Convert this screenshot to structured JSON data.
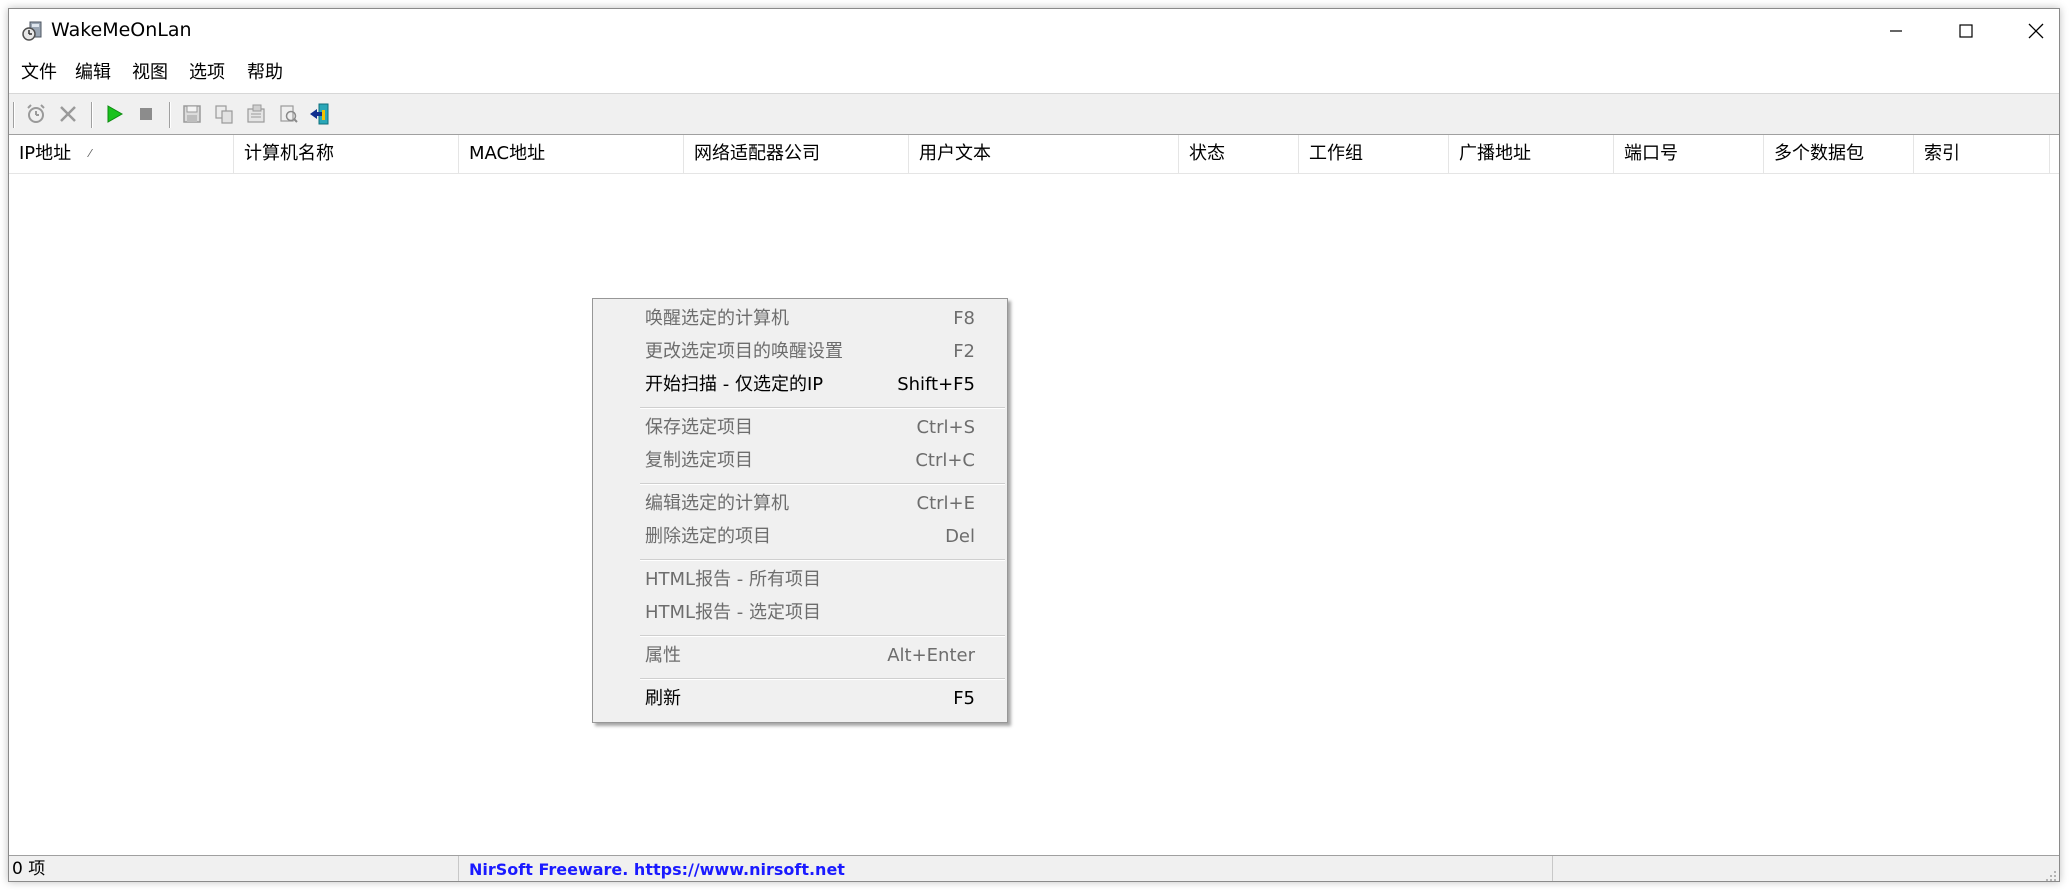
{
  "window": {
    "title": "WakeMeOnLan"
  },
  "menubar": {
    "items": [
      "文件",
      "编辑",
      "视图",
      "选项",
      "帮助"
    ]
  },
  "toolbar": {
    "buttons": [
      "alarm-clock-icon",
      "delete-x-icon",
      "play-icon",
      "stop-icon",
      "save-icon",
      "copy-icon",
      "properties-icon",
      "html-report-icon",
      "exit-icon"
    ]
  },
  "list": {
    "columns": [
      "IP地址",
      "计算机名称",
      "MAC地址",
      "网络适配器公司",
      "用户文本",
      "状态",
      "工作组",
      "广播地址",
      "端口号",
      "多个数据包",
      "索引"
    ],
    "sorted_column_indicator": "⁄",
    "rows": []
  },
  "context_menu": {
    "items": [
      {
        "label": "唤醒选定的计算机",
        "shortcut": "F8",
        "enabled": false
      },
      {
        "label": "更改选定项目的唤醒设置",
        "shortcut": "F2",
        "enabled": false
      },
      {
        "label": "开始扫描 - 仅选定的IP",
        "shortcut": "Shift+F5",
        "enabled": true
      },
      {
        "label": "保存选定项目",
        "shortcut": "Ctrl+S",
        "enabled": false
      },
      {
        "label": "复制选定项目",
        "shortcut": "Ctrl+C",
        "enabled": false
      },
      {
        "label": "编辑选定的计算机",
        "shortcut": "Ctrl+E",
        "enabled": false
      },
      {
        "label": "删除选定的项目",
        "shortcut": "Del",
        "enabled": false
      },
      {
        "label": "HTML报告 - 所有项目",
        "shortcut": "",
        "enabled": false
      },
      {
        "label": "HTML报告 - 选定项目",
        "shortcut": "",
        "enabled": false
      },
      {
        "label": "属性",
        "shortcut": "Alt+Enter",
        "enabled": false
      },
      {
        "label": "刷新",
        "shortcut": "F5",
        "enabled": true
      }
    ]
  },
  "statusbar": {
    "count": "0 项",
    "link": "NirSoft Freeware. https://www.nirsoft.net"
  },
  "colors": {
    "link": "#1a1aff",
    "disabled_text": "#6d6d6d",
    "menu_bg": "#f0f0f0"
  }
}
